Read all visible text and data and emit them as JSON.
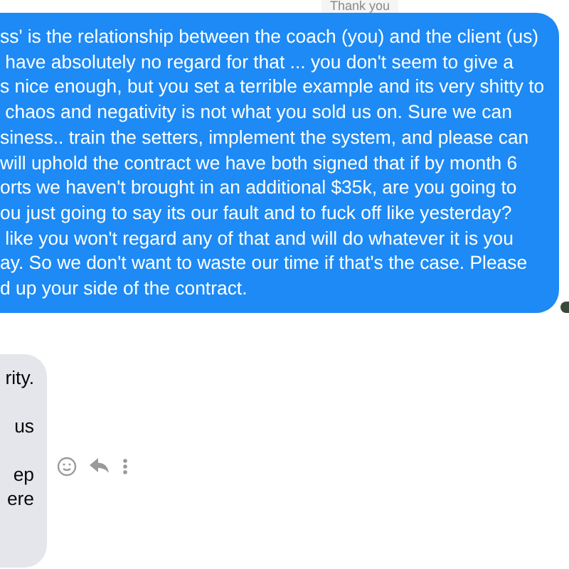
{
  "previous_caption": "Thank you",
  "sent_message": {
    "lines": [
      "ss' is the relationship between the coach (you) and the client (us)",
      " have absolutely no regard for that ... you don't seem to give a",
      "s nice enough, but you set a terrible example and its very shitty to",
      " chaos and negativity is not what you sold us on. Sure we can",
      "siness.. train the setters, implement the system, and please can",
      "will uphold the contract we have both signed that if by month 6",
      "orts we haven't brought in an additional $35k, are you going to",
      "ou just going to say its our fault and to fuck off like yesterday?",
      " like you won't regard any of that and will do whatever it is you",
      "ay. So we don't want to waste our time if that's the case. Please",
      "d up your side of the contract."
    ]
  },
  "received_message": {
    "lines": [
      "rity.",
      "us",
      "ep",
      "ere"
    ]
  }
}
